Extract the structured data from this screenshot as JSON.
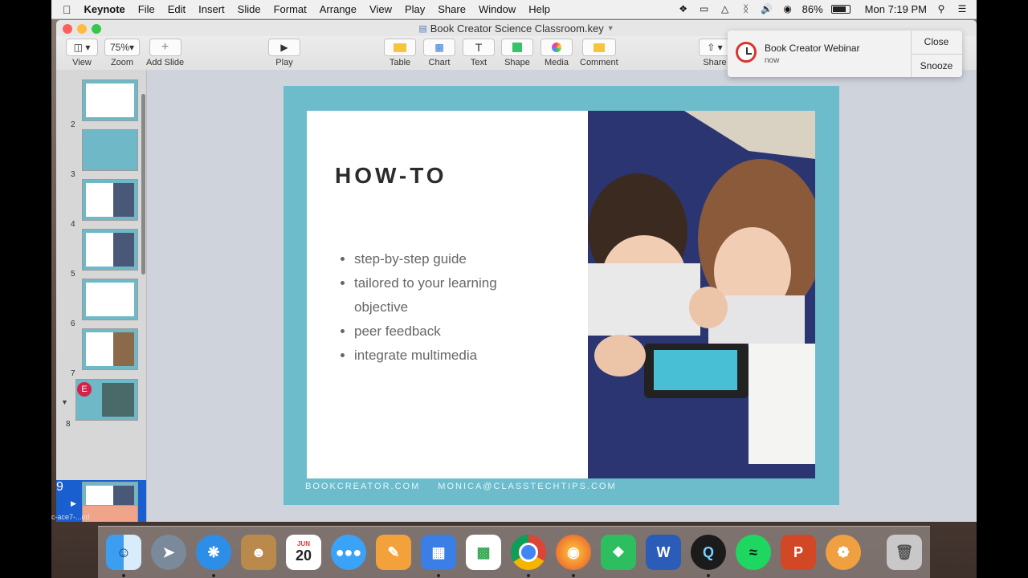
{
  "menubar": {
    "apple": "",
    "app": "Keynote",
    "items": [
      "File",
      "Edit",
      "Insert",
      "Slide",
      "Format",
      "Arrange",
      "View",
      "Play",
      "Share",
      "Window",
      "Help"
    ],
    "battery": "86%",
    "clock": "Mon 7:19 PM"
  },
  "window": {
    "title": "Book Creator Science Classroom.key"
  },
  "toolbar": {
    "view": "View",
    "zoom": "Zoom",
    "zoom_value": "75%",
    "add_slide": "Add Slide",
    "play": "Play",
    "table": "Table",
    "chart": "Chart",
    "text": "Text",
    "shape": "Shape",
    "media": "Media",
    "comment": "Comment",
    "share": "Share"
  },
  "sidebar": {
    "slides": [
      "2",
      "3",
      "4",
      "5",
      "6",
      "7",
      "8",
      "9"
    ],
    "selected": "9",
    "comment_badge": "E"
  },
  "slide": {
    "title": "HOW-TO",
    "bullets": [
      "step-by-step guide",
      "tailored to your learning objective",
      "peer feedback",
      "integrate multimedia"
    ],
    "footer_left": "BOOKCREATOR.COM",
    "footer_right": "MONICA@CLASSTECHTIPS.COM"
  },
  "notification": {
    "title": "Book Creator Webinar",
    "time": "now",
    "close": "Close",
    "snooze": "Snooze"
  },
  "dock": {
    "calendar_month": "JUN",
    "calendar_day": "20"
  },
  "download_strip": {
    "line1": "c-ace7-...ed"
  },
  "colors": {
    "slide_teal": "#6cbccc",
    "selection_blue": "#1a5fd0",
    "menubar_bg": "#f0f0f0"
  }
}
